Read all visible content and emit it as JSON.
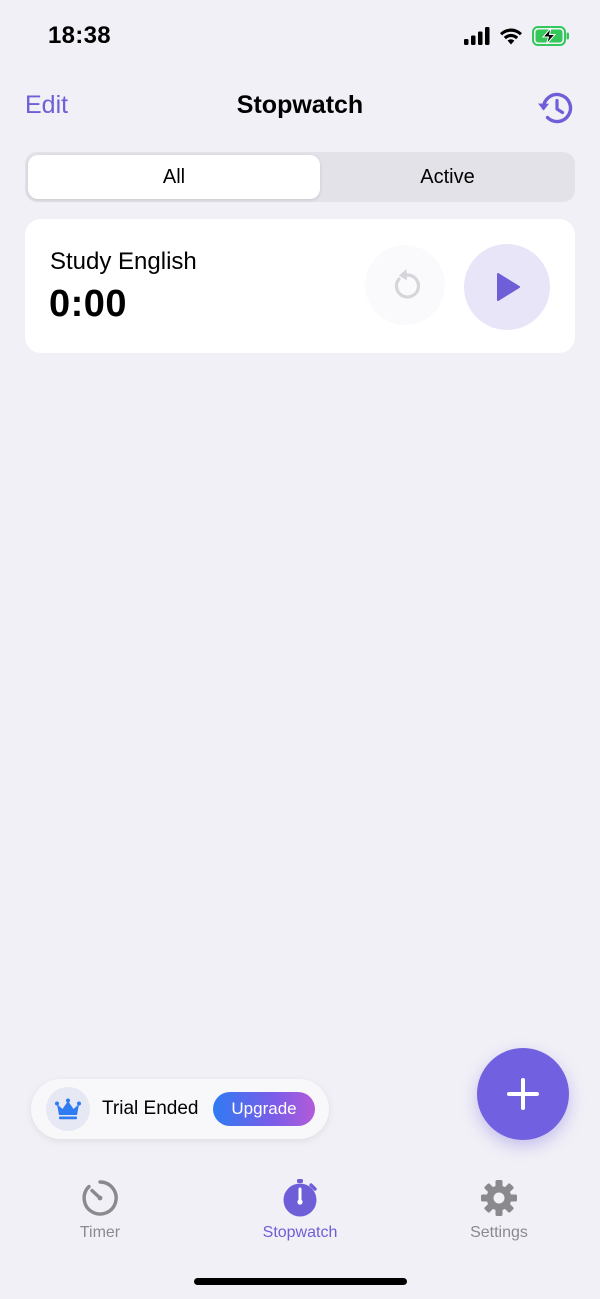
{
  "status_bar": {
    "time": "18:38",
    "icons": [
      "signal-icon",
      "wifi-icon",
      "battery-charging-icon"
    ]
  },
  "nav": {
    "edit_label": "Edit",
    "title": "Stopwatch",
    "history_icon": "history-icon"
  },
  "segments": {
    "all_label": "All",
    "active_label": "Active",
    "selected": "All"
  },
  "stopwatches": [
    {
      "name": "Study English",
      "elapsed": "0:00",
      "reset_icon": "reset-icon",
      "play_icon": "play-icon"
    }
  ],
  "trial": {
    "crown_icon": "crown-icon",
    "text": "Trial Ended",
    "upgrade_label": "Upgrade"
  },
  "fab": {
    "icon": "plus-icon"
  },
  "tabs": [
    {
      "label": "Timer",
      "icon": "timer-icon",
      "selected": false
    },
    {
      "label": "Stopwatch",
      "icon": "stopwatch-icon",
      "selected": true
    },
    {
      "label": "Settings",
      "icon": "gear-icon",
      "selected": false
    }
  ],
  "colors": {
    "accent": "#6E5FD8",
    "background": "#F1F0F6",
    "tab_inactive": "#8A8A8E",
    "upgrade_gradient_start": "#2F7BF2",
    "upgrade_gradient_end": "#B35BD9"
  }
}
